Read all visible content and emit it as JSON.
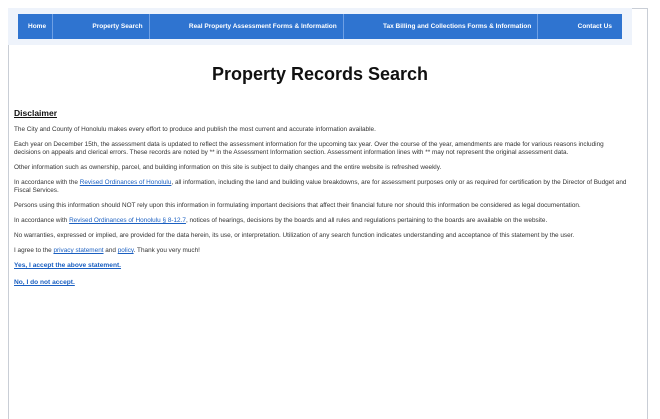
{
  "nav": {
    "items": [
      {
        "label": "Home"
      },
      {
        "label": "Property Search"
      },
      {
        "label": "Real Property Assessment Forms & Information"
      },
      {
        "label": "Tax Billing and Collections Forms & Information"
      },
      {
        "label": "Contact Us"
      }
    ]
  },
  "page": {
    "title": "Property Records Search"
  },
  "disclaimer": {
    "heading": "Disclaimer",
    "p1": "The City and County of Honolulu makes every effort to produce and publish the most current and accurate information available.",
    "p2": "Each year on December 15th, the assessment data is updated to reflect the assessment information for the upcoming tax year.  Over the course of the year, amendments are made for various reasons including decisions on appeals and clerical errors.  These records are noted by ** in the Assessment Information section.  Assessment information lines with ** may not represent the original assessment data.",
    "p3": "Other information such as ownership, parcel, and building information on this site is subject to daily changes and the entire website is refreshed weekly.",
    "p4_before": "In accordance with the ",
    "p4_link": "Revised Ordinances of Honolulu",
    "p4_after": ", all information, including the land and building value breakdowns, are for assessment purposes only or as required for certification by the Director of Budget and Fiscal Services.",
    "p5": "Persons using this information should NOT rely upon this information in formulating important decisions that affect their financial future nor should this information be considered as legal documentation.",
    "p6_before": "In accordance with ",
    "p6_link": "Revised Ordinances of Honolulu § 8-12.7",
    "p6_after": ", notices of hearings, decisions by the boards and all rules and regulations pertaining to the boards are available on the website.",
    "p7": "No warranties, expressed or implied, are provided for the data herein, its use, or interpretation.  Utilization of any search function indicates understanding and acceptance of this statement by the user.",
    "p8_before": "I agree to the ",
    "p8_link1": "privacy statement",
    "p8_mid": " and ",
    "p8_link2": "policy",
    "p8_after": ".  Thank you very much!",
    "accept_label": "Yes, I accept the above statement.",
    "decline_label": "No, I do not accept."
  },
  "colors": {
    "nav_bar": "#2f74d0",
    "nav_band": "#eef3fb",
    "link": "#1a5fc1"
  }
}
